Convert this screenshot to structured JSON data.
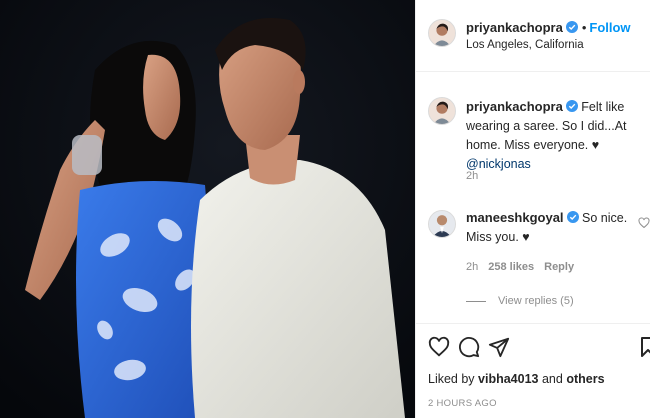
{
  "post": {
    "author": "priyankachopra",
    "header_separator": "•",
    "follow_label": "Follow",
    "location": "Los Angeles, California"
  },
  "caption": {
    "username": "priyankachopra",
    "text": " Felt like wearing a saree. So I did...At home. Miss everyone. ♥ ",
    "mention": "@nickjonas",
    "time": "2h"
  },
  "reply": {
    "username": "maneeshkgoyal",
    "text": " So nice. Miss you. ♥",
    "time": "2h",
    "likes": "258 likes",
    "reply_label": "Reply"
  },
  "view_replies": "View replies (5)",
  "likes_line": {
    "prefix": "Liked by ",
    "user": "vibha4013",
    "and": " and ",
    "others": "others"
  },
  "timestamp": "2 HOURS AGO",
  "colors": {
    "accent": "#0095f6",
    "verified": "#3897f0",
    "mention": "#00376b",
    "secondary": "#8e8e8e",
    "saree": "#2f6be0"
  },
  "icons": [
    "verified-badge-icon",
    "heart-icon",
    "comment-icon",
    "share-icon",
    "save-icon"
  ]
}
